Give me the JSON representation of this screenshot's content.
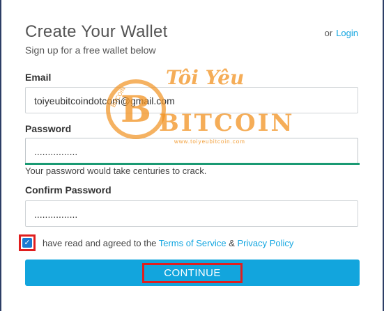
{
  "header": {
    "title": "Create Your Wallet",
    "subtitle": "Sign up for a free wallet below",
    "or_text": "or",
    "login_link": "Login"
  },
  "form": {
    "email": {
      "label": "Email",
      "value": "toiyeubitcoindotcom@gmail.com"
    },
    "password": {
      "label": "Password",
      "value": "................",
      "strength_message": "Your password would take centuries to crack.",
      "strength_color": "#1a9a73"
    },
    "confirm_password": {
      "label": "Confirm Password",
      "value": "................"
    },
    "agreement": {
      "checked": true,
      "text_prefix": "have read and agreed to the",
      "terms_link": "Terms of Service",
      "amp": "&",
      "privacy_link": "Privacy Policy"
    },
    "continue_label": "CONTINUE"
  },
  "watermark": {
    "line1": "Tôi Yêu",
    "line2": "BITCOIN",
    "url": "www.toiyeubitcoin.com",
    "coin_text": "BITCOIN",
    "coin_letter": "B"
  },
  "colors": {
    "accent": "#12a5dd",
    "link": "#10a5e0",
    "highlight": "#e01e1e",
    "watermark": "#f19220"
  }
}
